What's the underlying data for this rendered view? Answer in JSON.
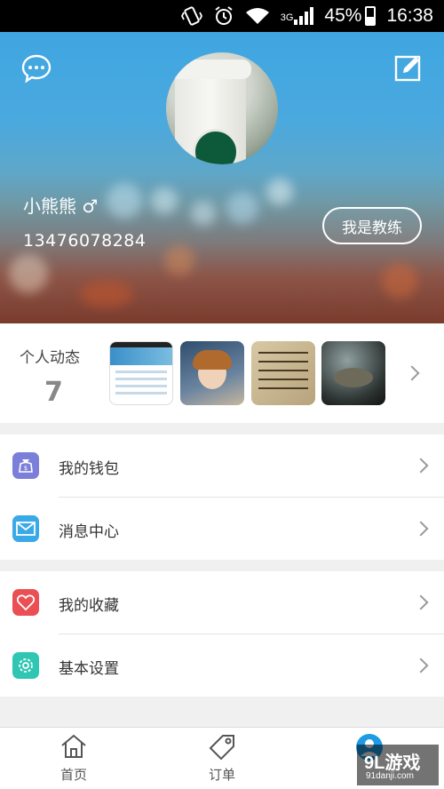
{
  "status_bar": {
    "network": "3G",
    "battery": "45%",
    "time": "16:38"
  },
  "profile": {
    "name": "小熊熊 ♂",
    "phone": "13476078284",
    "coach_button": "我是教练"
  },
  "activity": {
    "label": "个人动态",
    "count": "7"
  },
  "menu_group_1": [
    {
      "label": "我的钱包",
      "icon": "wallet-icon",
      "color": "#7b7fd9"
    },
    {
      "label": "消息中心",
      "icon": "mail-icon",
      "color": "#3aa9e8"
    }
  ],
  "menu_group_2": [
    {
      "label": "我的收藏",
      "icon": "heart-icon",
      "color": "#ea4f54"
    },
    {
      "label": "基本设置",
      "icon": "gear-icon",
      "color": "#2fc6b3"
    }
  ],
  "bottom_nav": [
    {
      "label": "首页",
      "icon": "home-icon"
    },
    {
      "label": "订单",
      "icon": "tag-icon"
    },
    {
      "label": "",
      "icon": "profile-icon"
    }
  ],
  "colors": {
    "header_blue": "#3fa6e0",
    "accent": "#1e9be2"
  },
  "watermark": {
    "brand": "9L游戏",
    "site": "91danji.com"
  }
}
